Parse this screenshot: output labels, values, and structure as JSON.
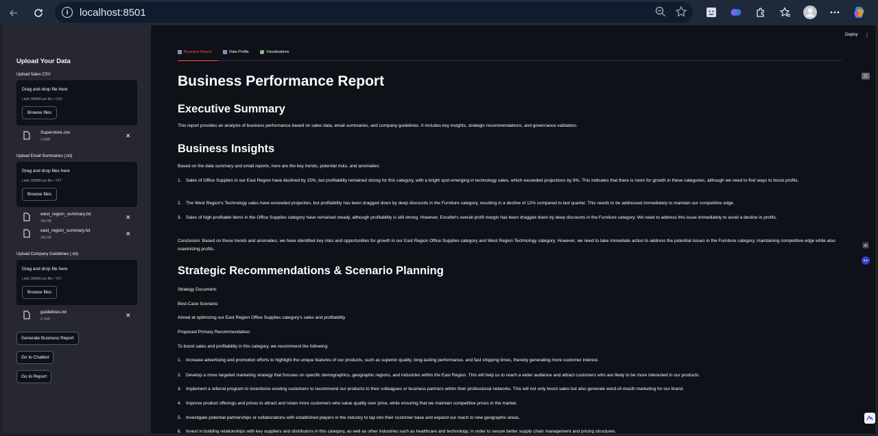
{
  "browser": {
    "url": "localhost:8501"
  },
  "sidebar": {
    "title": "Upload Your Data",
    "sections": [
      {
        "label": "Upload Sales CSV",
        "drop_title": "Drag and drop file here",
        "limit": "Limit 200MB per file • CSV",
        "browse_label": "Browse files",
        "files": [
          {
            "name": "Superstore.csv",
            "size": "2.0MB"
          }
        ]
      },
      {
        "label": "Upload Email Summaries (.txt)",
        "drop_title": "Drag and drop files here",
        "limit": "Limit 200MB per file • TXT",
        "browse_label": "Browse files",
        "files": [
          {
            "name": "west_region_summary.txt",
            "size": "369.0B"
          },
          {
            "name": "east_region_summary.txt",
            "size": "363.0B"
          }
        ]
      },
      {
        "label": "Upload Company Guidelines (.txt)",
        "drop_title": "Drag and drop file here",
        "limit": "Limit 200MB per file • TXT",
        "browse_label": "Browse files",
        "files": [
          {
            "name": "guidelines.txt",
            "size": "0.7KB"
          }
        ]
      }
    ],
    "buttons": {
      "generate": "Generate Business Report",
      "chatbot": "Go to Chatbot",
      "report": "Go to Report"
    }
  },
  "header": {
    "deploy": "Deploy"
  },
  "tabs": [
    {
      "label": "Business Report",
      "active": true
    },
    {
      "label": "Data Profile",
      "active": false
    },
    {
      "label": "Visualizations",
      "active": false
    }
  ],
  "report": {
    "title": "Business Performance Report",
    "exec_heading": "Executive Summary",
    "exec_text": "This report provides an analysis of business performance based on sales data, email summaries, and company guidelines. It includes key insights, strategic recommendations, and governance validation.",
    "insights_heading": "Business Insights",
    "insights_intro": "Based on the data summary and email reports, here are the key trends, potential risks, and anomalies:",
    "insights": [
      "Sales of Office Supplies in our East Region have declined by 15%, but profitability remained strong for this category, with a bright spot emerging in technology sales, which exceeded projections by 8%. This indicates that there is room for growth in these categories, although we need to find ways to boost profits.",
      "The West Region's Technology sales have exceeded projection, but profitability has been dragged down by deep discounts in the Furniture category, resulting in a decline of 12% compared to last quarter. This needs to be addressed immediately to maintain our competitive edge.",
      "Sales of high-profitable items in the Office Supplies category have remained steady, although profitability is still strong. However, Excellet's overall profit margin has been dragged down by deep discounts in the Furniture category. We need to address this issue immediately to avoid a decline in profits."
    ],
    "conclusion": "Conclusion: Based on these trends and anomalies, we have identified key risks and opportunities for growth in our East Region Office Supplies category and West Region Technology category. However, we need to take immediate action to address the potential issues in the Furniture category, maintaining competitive edge while also maximizing profits.",
    "strategy_heading": "Strategic Recommendations & Scenario Planning",
    "strategy_doc": "Strategy Document:",
    "best_case": "Best-Case Scenario:",
    "aim": "Aimed at optimizing our East Region Office Supplies category's sales and profitability",
    "proposed": "Proposed Primary Recommendation:",
    "recommend_intro": "To boost sales and profitability in this category, we recommend the following:",
    "recommendations": [
      "Increase advertising and promotion efforts to highlight the unique features of our products, such as superior quality, long-lasting performance, and fast shipping times, thereby generating more customer interest.",
      "Develop a more targeted marketing strategy that focuses on specific demographics, geographic regions, and industries within the East Region. This will help us to reach a wider audience and attract customers who are likely to be more interested in our products.",
      "Implement a referral program to incentivize existing customers to recommend our products to their colleagues or business partners within their professional networks. This will not only boost sales but also generate word-of-mouth marketing for our brand.",
      "Improve product offerings and prices to attract and retain more customers who value quality over price, while ensuring that we maintain competitive prices in the market.",
      "Investigate potential partnerships or collaborations with established players in the industry to tap into their customer base and expand our reach to new geographic areas.",
      "Invest in building relationships with key suppliers and distributors in this category, as well as other industries such as healthcare and technology, in order to secure better supply chain management and pricing structures."
    ]
  }
}
